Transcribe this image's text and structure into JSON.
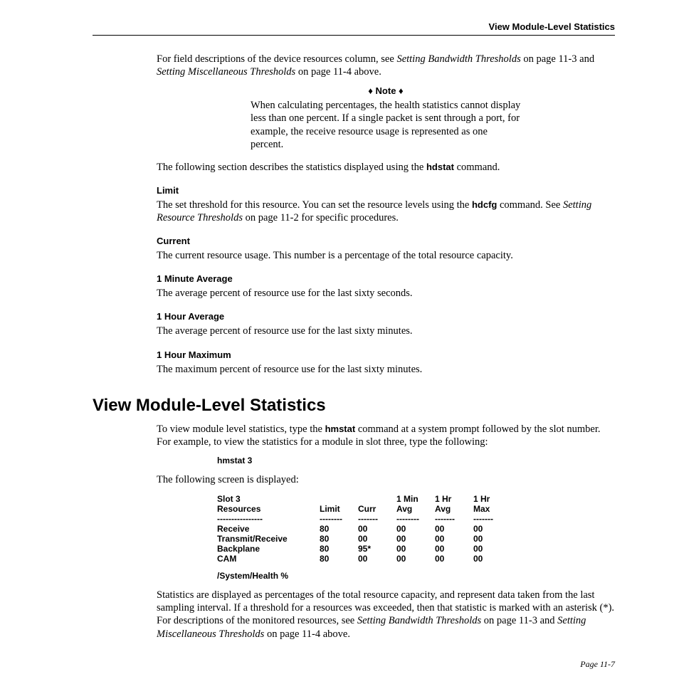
{
  "header": {
    "running": "View Module-Level Statistics"
  },
  "intro": {
    "p1_a": "For field descriptions of the device resources column, see ",
    "p1_i1": "Setting Bandwidth Thresholds",
    "p1_b": " on page 11-3 and ",
    "p1_i2": "Setting Miscellaneous Thresholds",
    "p1_c": " on page 11-4 above."
  },
  "note": {
    "label": "♦ Note ♦",
    "text": "When calculating percentages, the health statistics cannot display less than one percent. If a single packet is sent through a port, for example, the receive resource usage is represented as one percent."
  },
  "p2_a": "The following section describes the statistics displayed using the ",
  "p2_cmd": "hdstat",
  "p2_b": " command.",
  "limit": {
    "head": "Limit",
    "a": "The set threshold for this resource. You can set the resource levels using the ",
    "cmd": "hdcfg",
    "b": " command. See ",
    "i": "Setting Resource Thresholds",
    "c": " on page 11-2 for specific procedures."
  },
  "current": {
    "head": "Current",
    "text": "The current resource usage. This number is a percentage of the total resource capacity."
  },
  "minavg": {
    "head": "1 Minute Average",
    "text": "The average percent of resource use for the last sixty seconds."
  },
  "houravg": {
    "head": "1 Hour Average",
    "text": "The average percent of resource use for the last sixty minutes."
  },
  "hourmax": {
    "head": "1 Hour Maximum",
    "text": "The maximum percent of resource use for the last sixty minutes."
  },
  "section": {
    "title": "View Module-Level Statistics",
    "p1_a": "To view module level statistics, type the ",
    "p1_cmd": "hmstat",
    "p1_b": " command at a system prompt followed by the slot number. For example, to view the statistics for a module in slot three, type the following:",
    "example": "hmstat 3",
    "p2": "The following screen is displayed:"
  },
  "table": {
    "h1a": "Slot 3",
    "h1b": "Resources",
    "h2": "Limit",
    "h3": "Curr",
    "h4a": "1 Min",
    "h4b": "Avg",
    "h5a": "1 Hr",
    "h5b": "Avg",
    "h6a": "1 Hr",
    "h6b": "Max",
    "dash1": "----------------",
    "dash2": "--------",
    "dash3": "-------",
    "dash4": "--------",
    "dash5": "-------",
    "dash6": "-------",
    "rows": [
      {
        "name": "Receive",
        "limit": "80",
        "curr": "00",
        "minavg": "00",
        "hravg": "00",
        "hrmax": "00"
      },
      {
        "name": "Transmit/Receive",
        "limit": "80",
        "curr": "00",
        "minavg": "00",
        "hravg": "00",
        "hrmax": "00"
      },
      {
        "name": "Backplane",
        "limit": "80",
        "curr": "95*",
        "minavg": "00",
        "hravg": "00",
        "hrmax": "00"
      },
      {
        "name": "CAM",
        "limit": "80",
        "curr": "00",
        "minavg": "00",
        "hravg": "00",
        "hrmax": "00"
      }
    ],
    "footer": "/System/Health %"
  },
  "closing": {
    "a": "Statistics are displayed as percentages of the total resource capacity, and represent data taken from the last sampling interval. If a threshold for a resources was exceeded, then that statistic is marked with an asterisk (*). For descriptions of the monitored resources, see ",
    "i1": "Setting Bandwidth Thresholds",
    "b": " on page 11-3 and ",
    "i2": "Setting Miscellaneous Thresholds",
    "c": " on page 11-4 above."
  },
  "pagenum": "Page 11-7"
}
